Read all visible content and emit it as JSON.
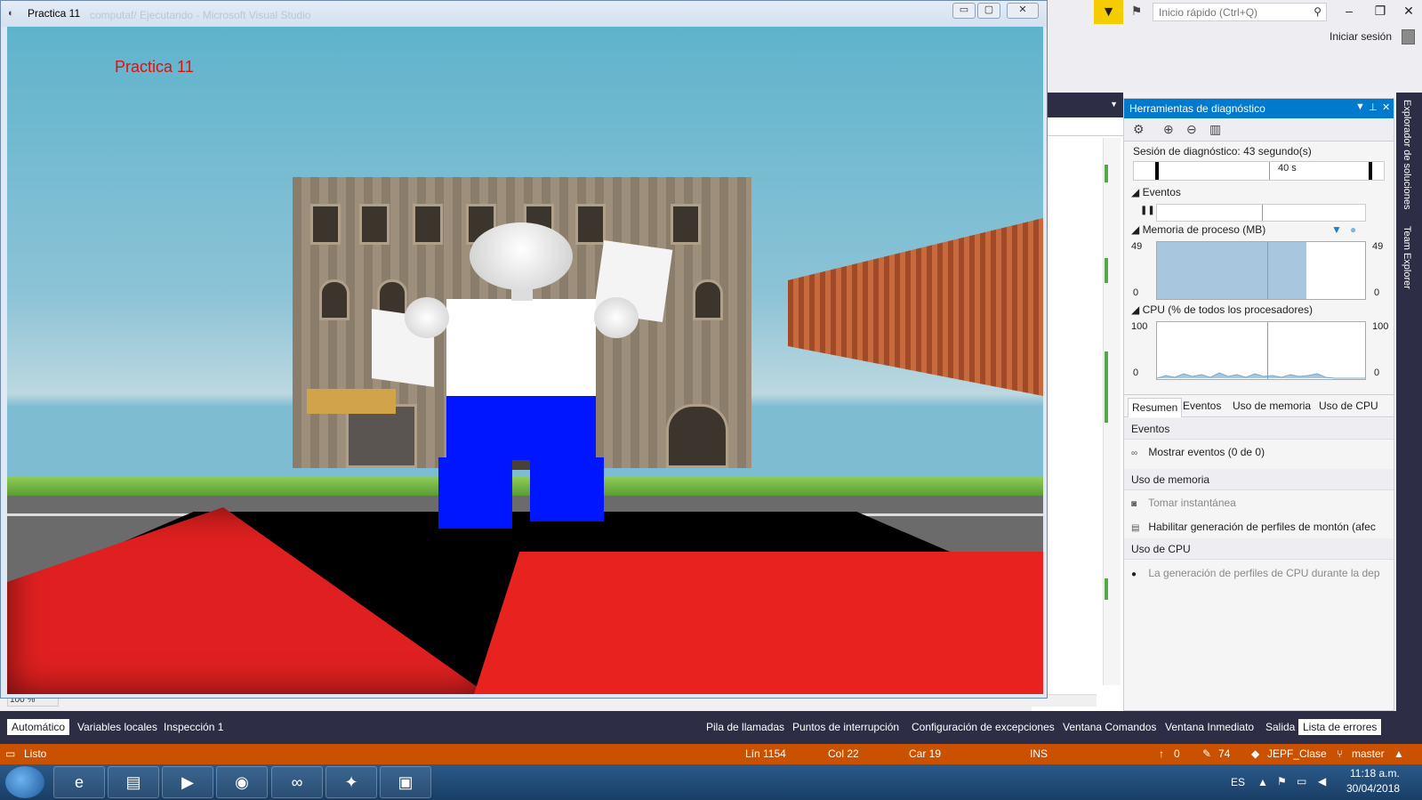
{
  "app_window": {
    "title": "Practica 11",
    "ghost_title": "computaf/ Ejecutando - Microsoft Visual Studio",
    "scene_label": "Practica 11",
    "min": "▭",
    "max": "▢",
    "close": "✕"
  },
  "vs": {
    "quick_launch_placeholder": "Inicio rápido (Ctrl+Q)",
    "sign_in": "Iniciar sesión",
    "zoom": "100 %"
  },
  "diagnostics": {
    "title": "Herramientas de diagnóstico",
    "session": "Sesión de diagnóstico: 43 segundo(s)",
    "timeline_label": "40 s",
    "events_header": "Eventos",
    "memory_header": "Memoria de proceso (MB)",
    "memory_max": "49",
    "memory_min": "0",
    "memory_fill_fraction": 0.72,
    "cpu_header": "CPU (% de todos los procesadores)",
    "cpu_max": "100",
    "cpu_min": "0",
    "tabs": [
      "Resumen",
      "Eventos",
      "Uso de memoria",
      "Uso de CPU"
    ],
    "summary": {
      "events_title": "Eventos",
      "show_events": "Mostrar eventos (0 de 0)",
      "memory_title": "Uso de memoria",
      "snapshot": "Tomar instantánea",
      "heap_profiling": "Habilitar generación de perfiles de montón (afec",
      "cpu_title": "Uso de CPU",
      "cpu_profiling": "La generación de perfiles de CPU durante la dep"
    }
  },
  "vertical_tabs": [
    "Explorador de soluciones",
    "Team Explorer"
  ],
  "bottom_tabs_left": [
    "Automático",
    "Variables locales",
    "Inspección 1"
  ],
  "bottom_tabs_right": [
    "Pila de llamadas",
    "Puntos de interrupción",
    "Configuración de excepciones",
    "Ventana Comandos",
    "Ventana Inmediato",
    "Salida",
    "Lista de errores"
  ],
  "status_bar": {
    "state": "Listo",
    "line": "Lín 1154",
    "col": "Col 22",
    "car": "Car 19",
    "mode": "INS",
    "push": "0",
    "edits": "74",
    "repo": "JEPF_Clase",
    "branch": "master"
  },
  "taskbar": {
    "lang": "ES",
    "time": "11:18 a.m.",
    "date": "30/04/2018"
  }
}
